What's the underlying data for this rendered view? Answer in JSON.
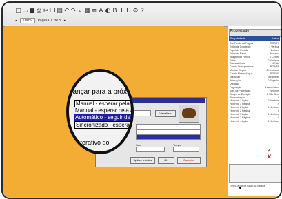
{
  "toolbar": {
    "icons": [
      "new-icon",
      "open-icon",
      "save-icon",
      "print-icon",
      "cut-icon",
      "copy-icon",
      "paste-icon",
      "undo-icon",
      "redo-icon",
      "zoom-icon",
      "grid-icon",
      "align-icon",
      "font-icon",
      "color-icon",
      "bold-icon",
      "italic-icon",
      "underline-icon",
      "settings-icon",
      "help-icon"
    ],
    "row2": [
      "Página 1 de 5"
    ]
  },
  "right_panel": {
    "title": "Propriedade",
    "col1": "Propriedade",
    "col2": "Valor",
    "rows": [
      [
        "Cor Fundo da Página",
        "RGB(F7"
      ],
      [
        "Estilo de Gradiente",
        "1 Vertical"
      ],
      [
        "Papel de Parede",
        "Nenhum"
      ],
      [
        "Estilo do Papel",
        "Mosaico"
      ],
      [
        "Imagem do Fundo",
        "0 Centro"
      ],
      [
        "Estilo",
        "0 Nenhum"
      ],
      [
        "Transparência",
        "0 Não"
      ],
      [
        "Cor de Transparência",
        "RGB(FF"
      ],
      [
        "Mostrar Régua",
        "0 Nenhuma"
      ],
      [
        "Cor da Marca d'água",
        "RGB(00"
      ],
      [
        "Tradução",
        "4 Estrelas"
      ],
      [
        "Animação",
        "0 Superior"
      ],
      [
        "Duração",
        "1"
      ],
      [
        "Paginação",
        "1 Automático"
      ],
      [
        "Som da Paginação",
        "Nenhum"
      ],
      [
        "Tempo de Exibição",
        "0 Não Ativo"
      ],
      [
        "Sincronização",
        "0"
      ],
      [
        "Hiperlink 1 Ação",
        "0 Nenhum"
      ],
      [
        "Hiperlink 1 Página",
        "0"
      ],
      [
        "Hiperlink 2 Ação",
        "0 Nenhum"
      ],
      [
        "Hiperlink 2 Página",
        "0"
      ],
      [
        "Hiperlink 3 Ação",
        "0 Nenhum"
      ],
      [
        "Hiperlink 3 Página",
        "0"
      ],
      [
        "Hiperlink 4 Ação",
        "0 Nenhum"
      ]
    ],
    "footer": "Defina a cor de fundo da página."
  },
  "magnifier": {
    "line1": "Avançar para a próxim",
    "opt1": "Manual - esperar pela a",
    "opt2": "Manual - esperar pela a",
    "opt3": "Automático - seguir de ac",
    "opt4": "Sincronizado - esperar",
    "line_bottom": "o interativo do"
  },
  "dialog": {
    "label_top": "Transição",
    "btn_preview": "Visualizar",
    "label_sound": "Som",
    "label_time": "Tempo",
    "btn_apply": "Aplicar a todas",
    "btn_ok": "OK",
    "btn_cancel": "Cancelar"
  }
}
